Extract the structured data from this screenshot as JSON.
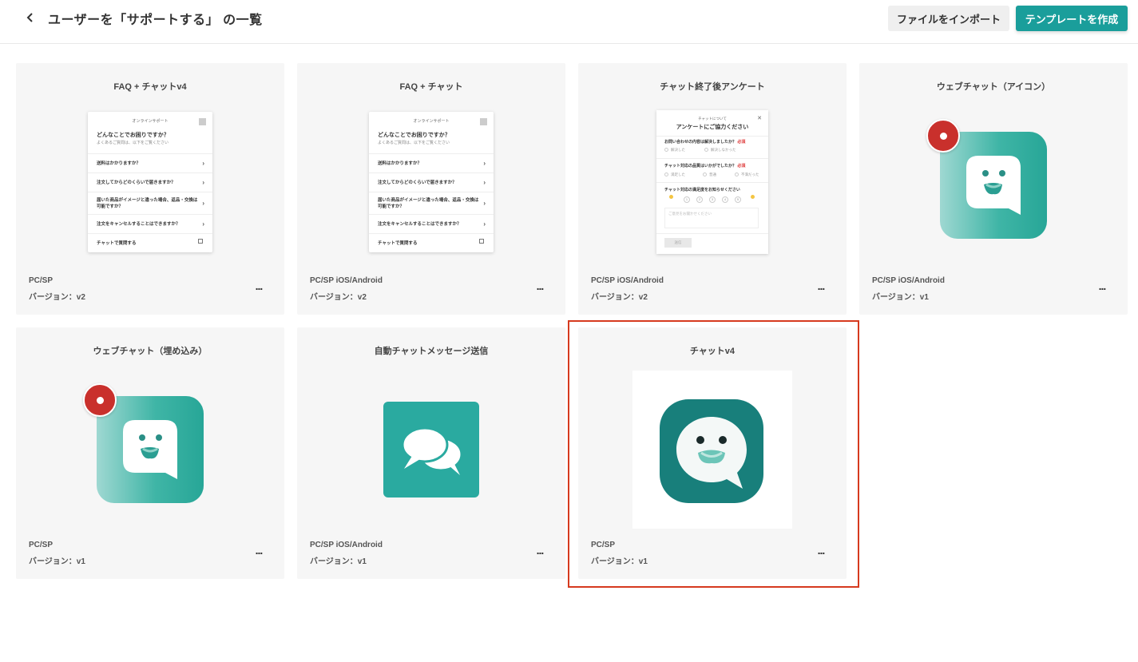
{
  "header": {
    "back_icon": "chevron-left-icon",
    "title": "ユーザーを「サポートする」 の一覧",
    "import_label": "ファイルをインポート",
    "create_label": "テンプレートを作成"
  },
  "colors": {
    "accent": "#1a9e9b",
    "card_bg": "#f6f6f6",
    "badge": "#c9302c",
    "highlight": "#d63a1f"
  },
  "cards": [
    {
      "title": "FAQ + チャットv4",
      "platform": "PC/SP",
      "version": "バージョン：v2",
      "more": "..."
    },
    {
      "title": "FAQ + チャット",
      "platform": "PC/SP iOS/Android",
      "version": "バージョン：v2",
      "more": "..."
    },
    {
      "title": "チャット終了後アンケート",
      "platform": "PC/SP iOS/Android",
      "version": "バージョン：v2",
      "more": "..."
    },
    {
      "title": "ウェブチャット（アイコン）",
      "platform": "PC/SP iOS/Android",
      "version": "バージョン：v1",
      "more": "..."
    },
    {
      "title": "ウェブチャット（埋め込み）",
      "platform": "PC/SP",
      "version": "バージョン：v1",
      "more": "..."
    },
    {
      "title": "自動チャットメッセージ送信",
      "platform": "PC/SP iOS/Android",
      "version": "バージョン：v1",
      "more": "..."
    },
    {
      "title": "チャットv4",
      "platform": "PC/SP",
      "version": "バージョン：v1",
      "more": "..."
    }
  ],
  "faq_preview": {
    "header": "オンラインサポート",
    "question": "どんなことでお困りですか？",
    "sub": "よくあるご質問は、以下をご覧ください",
    "items": [
      "送料はかかりますか？",
      "注文してからどのくらいで届きますか？",
      "届いた商品がイメージと違った場合、返品・交換は可能ですか？",
      "注文をキャンセルすることはできますか？"
    ],
    "footer": "チャットで質問する"
  },
  "survey_preview": {
    "small": "チャットについて",
    "title": "アンケートにご協力ください",
    "q1": "お問い合わせの内容は解決しましたか？",
    "q1_opts": [
      "解決した",
      "解決しなかった"
    ],
    "q2": "チャット対応の品質はいかがでしたか？",
    "q2_opts": [
      "満足した",
      "普通",
      "不満だった"
    ],
    "q3": "チャット対応の満足度をお知らせください",
    "scale": [
      "1",
      "2",
      "3",
      "4",
      "5"
    ],
    "required": "必須",
    "placeholder": "ご意見をお聞かせください",
    "submit": "送信"
  }
}
